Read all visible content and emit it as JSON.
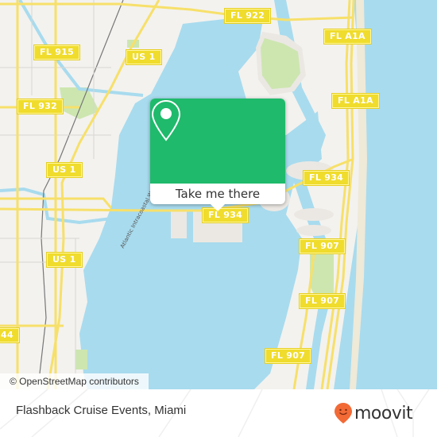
{
  "map": {
    "attribution": "© OpenStreetMap contributors",
    "colors": {
      "water": "#a8dbee",
      "land": "#f3f2ef",
      "park": "#cde6b0",
      "road": "#f7e06a",
      "shield": "#f0dc2c",
      "popup": "#1fba6b"
    },
    "road_labels": [
      {
        "id": "fl922",
        "text": "FL 922"
      },
      {
        "id": "fl915",
        "text": "FL 915"
      },
      {
        "id": "us1-top",
        "text": "US 1"
      },
      {
        "id": "fla1a-1",
        "text": "FL A1A"
      },
      {
        "id": "fla1a-2",
        "text": "FL A1A"
      },
      {
        "id": "fl932",
        "text": "FL 932"
      },
      {
        "id": "us1-mid",
        "text": "US 1"
      },
      {
        "id": "fl934-right",
        "text": "FL 934"
      },
      {
        "id": "fl934-center",
        "text": "FL 934"
      },
      {
        "id": "us1-bottom",
        "text": "US 1"
      },
      {
        "id": "fl907-1",
        "text": "FL 907"
      },
      {
        "id": "fl907-2",
        "text": "FL 907"
      },
      {
        "id": "fl907-3",
        "text": "FL 907"
      },
      {
        "id": "fl944",
        "text": "44"
      }
    ],
    "waterway_label": "Atlantic Intracoastal Waterway"
  },
  "popup": {
    "icon": "map-pin-icon",
    "action_label": "Take me there"
  },
  "footer": {
    "place_name": "Flashback Cruise Events, Miami",
    "brand": "moovit",
    "brand_color": "#f26a36"
  }
}
